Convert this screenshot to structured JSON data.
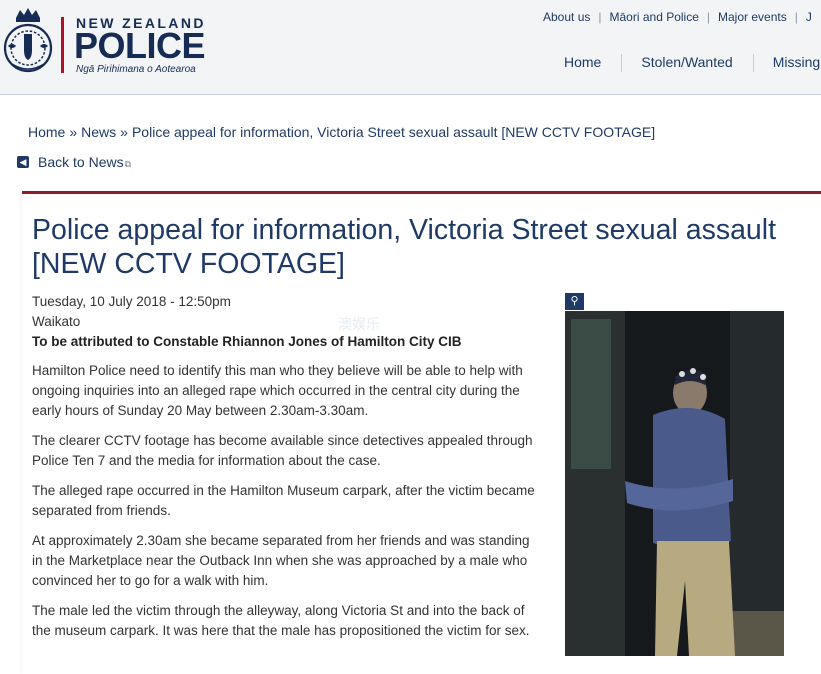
{
  "header": {
    "brand": {
      "country": "NEW ZEALAND",
      "name": "POLICE",
      "subtitle": "Ngā Pirihimana o Aotearoa"
    },
    "utility_nav": [
      "About us",
      "Māori and Police",
      "Major events",
      "J"
    ],
    "main_nav": [
      "Home",
      "Stolen/Wanted",
      "Missing"
    ]
  },
  "breadcrumb": {
    "home": "Home",
    "news": "News",
    "current": "Police appeal for information, Victoria Street sexual assault [NEW CCTV FOOTAGE]",
    "separator": "»"
  },
  "back_link": {
    "label": "Back to News"
  },
  "article": {
    "title": "Police appeal for information, Victoria Street sexual assault [NEW CCTV FOOTAGE]",
    "date": "Tuesday, 10 July 2018 - 12:50pm",
    "region": "Waikato",
    "attribution": "To be attributed to Constable Rhiannon Jones of Hamilton City CIB",
    "paragraphs": [
      "Hamilton Police need to identify this man who they believe will be able to help with ongoing inquiries into an alleged rape which occurred in the central city during the early hours of Sunday 20 May between 2.30am-3.30am.",
      "The clearer CCTV footage has become available since detectives appealed through Police Ten 7 and the media for information about the case.",
      "The alleged rape occurred in the Hamilton Museum carpark, after the victim became separated from friends.",
      "At approximately 2.30am she became separated from her friends and was standing in the Marketplace near the Outback Inn when she was approached by a male who convinced her to go for a walk with him.",
      "The male led the victim through the alleyway, along Victoria St and into the back of the museum carpark. It was here that the male has propositioned the victim for sex."
    ]
  },
  "watermark": "澳娱乐",
  "colors": {
    "brand_navy": "#172c55",
    "accent_red": "#b0102a",
    "link": "#1f3a66"
  }
}
